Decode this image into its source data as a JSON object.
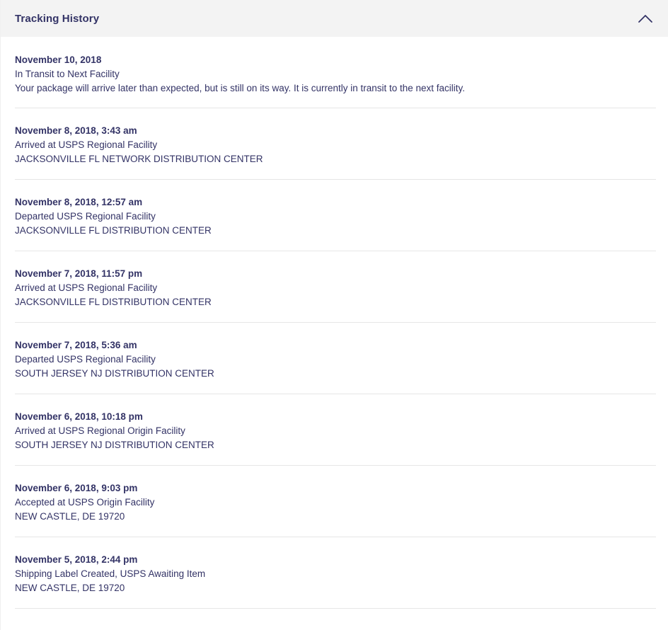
{
  "header": {
    "title": "Tracking History",
    "toggle_icon": "chevron-up-icon"
  },
  "colors": {
    "text": "#333366",
    "header_bg": "#f3f3f3",
    "divider": "#e6e6e6"
  },
  "events": [
    {
      "date": "November 10, 2018",
      "status": "In Transit to Next Facility",
      "detail": "Your package will arrive later than expected, but is still on its way. It is currently in transit to the next facility."
    },
    {
      "date": "November 8, 2018, 3:43 am",
      "status": "Arrived at USPS Regional Facility",
      "detail": "JACKSONVILLE FL NETWORK DISTRIBUTION CENTER"
    },
    {
      "date": "November 8, 2018, 12:57 am",
      "status": "Departed USPS Regional Facility",
      "detail": "JACKSONVILLE FL DISTRIBUTION CENTER"
    },
    {
      "date": "November 7, 2018, 11:57 pm",
      "status": "Arrived at USPS Regional Facility",
      "detail": "JACKSONVILLE FL DISTRIBUTION CENTER"
    },
    {
      "date": "November 7, 2018, 5:36 am",
      "status": "Departed USPS Regional Facility",
      "detail": "SOUTH JERSEY NJ DISTRIBUTION CENTER"
    },
    {
      "date": "November 6, 2018, 10:18 pm",
      "status": "Arrived at USPS Regional Origin Facility",
      "detail": "SOUTH JERSEY NJ DISTRIBUTION CENTER"
    },
    {
      "date": "November 6, 2018, 9:03 pm",
      "status": "Accepted at USPS Origin Facility",
      "detail": "NEW CASTLE, DE 19720"
    },
    {
      "date": "November 5, 2018, 2:44 pm",
      "status": "Shipping Label Created, USPS Awaiting Item",
      "detail": "NEW CASTLE, DE 19720"
    }
  ]
}
